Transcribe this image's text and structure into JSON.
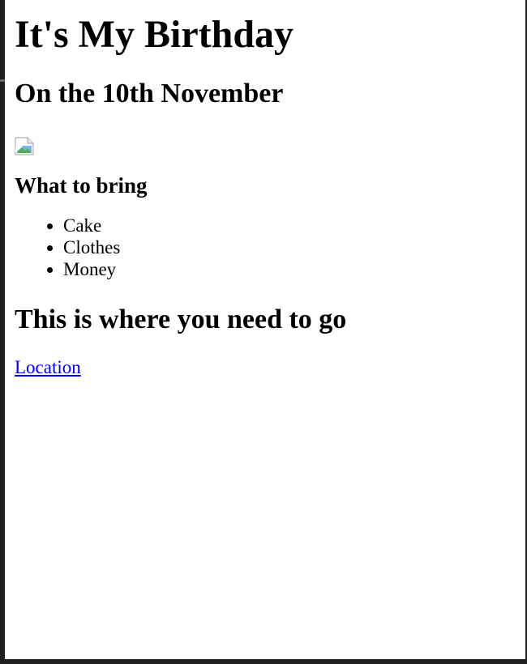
{
  "page": {
    "title": "It's My Birthday",
    "date_heading": "On the 10th November",
    "image_icon": "broken-image-icon",
    "bring_heading": "What to bring",
    "bring_items": [
      "Cake",
      "Clothes",
      "Money"
    ],
    "directions_heading": "This is where you need to go",
    "location_link": "Location"
  },
  "colors": {
    "frame": "#202020",
    "background": "#ffffff",
    "text": "#000000",
    "link": "#0000ee"
  }
}
